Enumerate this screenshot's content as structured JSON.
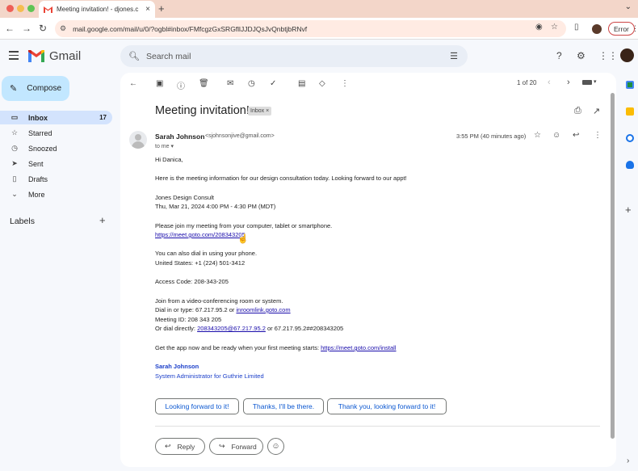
{
  "browser": {
    "tab_title": "Meeting invitation! - djones.c",
    "url": "mail.google.com/mail/u/0/?ogbl#inbox/FMfcgzGxSRGfllJJDJQsJvQnbtjbRNvf",
    "error_label": "Error"
  },
  "gmail": {
    "brand": "Gmail",
    "search_placeholder": "Search mail",
    "compose_label": "Compose"
  },
  "sidebar": {
    "items": [
      {
        "label": "Inbox",
        "icon": "inbox-icon",
        "count": "17"
      },
      {
        "label": "Starred",
        "icon": "star-icon",
        "count": ""
      },
      {
        "label": "Snoozed",
        "icon": "clock-icon",
        "count": ""
      },
      {
        "label": "Sent",
        "icon": "send-icon",
        "count": ""
      },
      {
        "label": "Drafts",
        "icon": "draft-icon",
        "count": ""
      },
      {
        "label": "More",
        "icon": "chevron-down-icon",
        "count": ""
      }
    ],
    "labels_header": "Labels"
  },
  "toolbar": {
    "pager": "1 of 20"
  },
  "email": {
    "subject": "Meeting invitation!",
    "chip": "Inbox",
    "sender_name": "Sarah Johnson",
    "sender_email": "<sjohnsonjive@gmail.com>",
    "to_me": "to me",
    "time": "3:55 PM (40 minutes ago)",
    "greeting": "Hi Danica,",
    "intro": "Here is the meeting information for our design consultation today. Looking forward to our appt!",
    "org": "Jones Design Consult",
    "datetime": "Thu, Mar 21, 2024 4:00 PM - 4:30 PM (MDT)",
    "join_text": "Please join my meeting from your computer, tablet or smartphone.",
    "meet_link": "https://meet.goto.com/208343205",
    "dial_text": "You can also dial in using your phone.",
    "us_phone": "United States: +1 (224) 501-3412",
    "access_code": "Access Code: 208-343-205",
    "room_text": "Join from a video-conferencing room or system.",
    "dial_in_prefix": "Dial in or type: 67.217.95.2 or ",
    "dial_in_link": "inroomlink.goto.com",
    "meeting_id": "Meeting ID: 208 343 205",
    "dial_direct_prefix": "Or dial directly: ",
    "dial_direct_link": "208343205@67.217.95.2",
    "dial_direct_suffix": " or 67.217.95.2##208343205",
    "app_prefix": "Get the app now and be ready when your first meeting starts: ",
    "app_link": "https://meet.goto.com/install",
    "sig_name": "Sarah Johnson",
    "sig_title": "System Administrator for Guthrie Limited"
  },
  "smart_replies": [
    "Looking forward to it!",
    "Thanks, I'll be there.",
    "Thank you, looking forward to it!"
  ],
  "actions": {
    "reply": "Reply",
    "forward": "Forward"
  },
  "colors": {
    "accent_blue": "#0b57d0",
    "compose_bg": "#c2e7ff",
    "active_nav": "#d3e3fd",
    "link": "#1a0dab"
  }
}
